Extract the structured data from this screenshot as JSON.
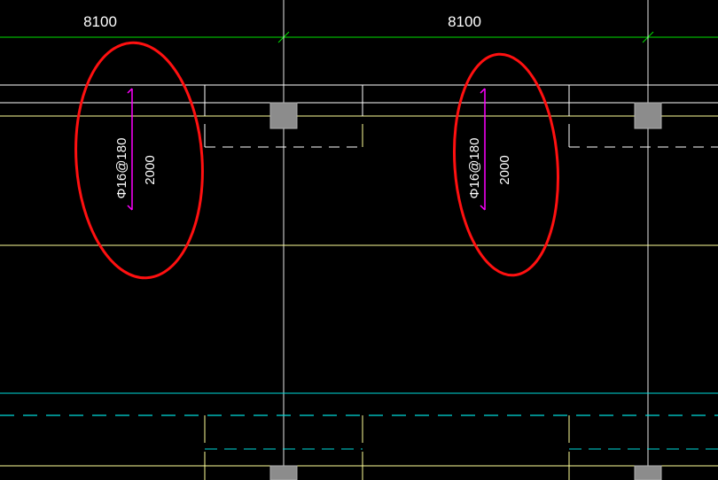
{
  "dimensions": {
    "left_span": "8100",
    "right_span": "8100"
  },
  "annotations": {
    "left": {
      "rebar_spec": "Φ16@180",
      "length": "2000"
    },
    "right": {
      "rebar_spec": "Φ16@180",
      "length": "2000"
    }
  },
  "colors": {
    "background": "#000000",
    "grid_axis": "#ffffff",
    "dimension_line": "#00ff00",
    "beam_line": "#ffff80",
    "slab_edge": "#ffffff",
    "dashed_cyan": "#00ffff",
    "rebar": "#ff00ff",
    "highlight_circle": "#ff0000",
    "column": "#808080"
  }
}
